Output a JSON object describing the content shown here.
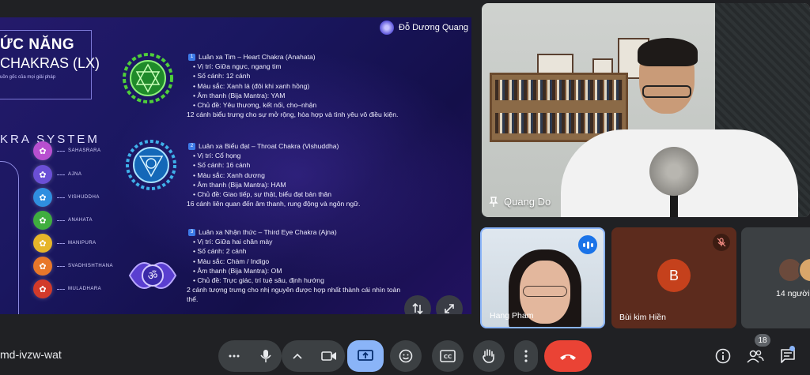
{
  "meeting": {
    "code": "md-ivzw-wat"
  },
  "slide": {
    "title_line1": "ỨC NĂNG",
    "title_line2": "CHAKRAS (LX)",
    "subtitle": "uồn gốc của mọi giải pháp",
    "system_label": "KRA SYSTEM",
    "presenter_brand": "Đỗ Dương Quang",
    "chakra_list": [
      {
        "name": "SAHASRARA",
        "color": "#b84fd0",
        "icon": "crown-chakra-icon"
      },
      {
        "name": "AJNA",
        "color": "#6a4fd6",
        "icon": "third-eye-chakra-icon"
      },
      {
        "name": "VISHUDDHA",
        "color": "#2f8ee0",
        "icon": "throat-chakra-icon"
      },
      {
        "name": "ANAHATA",
        "color": "#3fae3f",
        "icon": "heart-chakra-icon"
      },
      {
        "name": "MANIPURA",
        "color": "#e6b52a",
        "icon": "solar-plexus-chakra-icon"
      },
      {
        "name": "SVADHISHTHANA",
        "color": "#e8772a",
        "icon": "sacral-chakra-icon"
      },
      {
        "name": "MULADHARA",
        "color": "#d23a2a",
        "icon": "root-chakra-icon"
      }
    ],
    "chakras": [
      {
        "heading": "Luân xa Tim – Heart Chakra (Anahata)",
        "lines": [
          "Vị trí: Giữa ngực, ngang tim",
          "Số cánh: 12 cánh",
          "Màu sắc: Xanh lá (đôi khi xanh hồng)",
          "Âm thanh (Bija Mantra): YAM",
          "Chủ đề: Yêu thương, kết nối, cho–nhận"
        ],
        "summary": "12 cánh biểu trưng cho sự mở rộng, hòa hợp và tình yêu vô điều kiện.",
        "color": "#4fcf3a"
      },
      {
        "heading": "Luân xa Biểu đạt – Throat Chakra (Vishuddha)",
        "lines": [
          "Vị trí: Cổ họng",
          "Số cánh: 16 cánh",
          "Màu sắc: Xanh dương",
          "Âm thanh (Bija Mantra): HAM",
          "Chủ đề: Giao tiếp, sự thật, biểu đạt bản thân"
        ],
        "summary": "16 cánh liên quan đến âm thanh, rung động và ngôn ngữ.",
        "color": "#3fb0ea"
      },
      {
        "heading": "Luân xa Nhận thức – Third Eye Chakra (Ajna)",
        "lines": [
          "Vị trí: Giữa hai chân mày",
          "Số cánh: 2 cánh",
          "Màu sắc: Chàm / Indigo",
          "Âm thanh (Bija Mantra): OM",
          "Chủ đề: Trực giác, trí tuệ sâu, định hướng"
        ],
        "summary_1": "2 cánh tượng trưng cho nhị nguyên được hợp nhất thành cái nhìn toàn",
        "summary_2": "thể.",
        "color": "#7a5ae0"
      }
    ]
  },
  "participants": {
    "main": {
      "name": "Quang Do"
    },
    "tiles": [
      {
        "name": "Hang Pham"
      },
      {
        "name": "Bùi kim Hiền",
        "initial": "B",
        "avatar_color": "#c5411c"
      }
    ],
    "more_label": "14 người",
    "count": "18"
  },
  "colors": {
    "end_call": "#ea4335",
    "active": "#8ab4f8",
    "control_bg": "#3c4043"
  }
}
